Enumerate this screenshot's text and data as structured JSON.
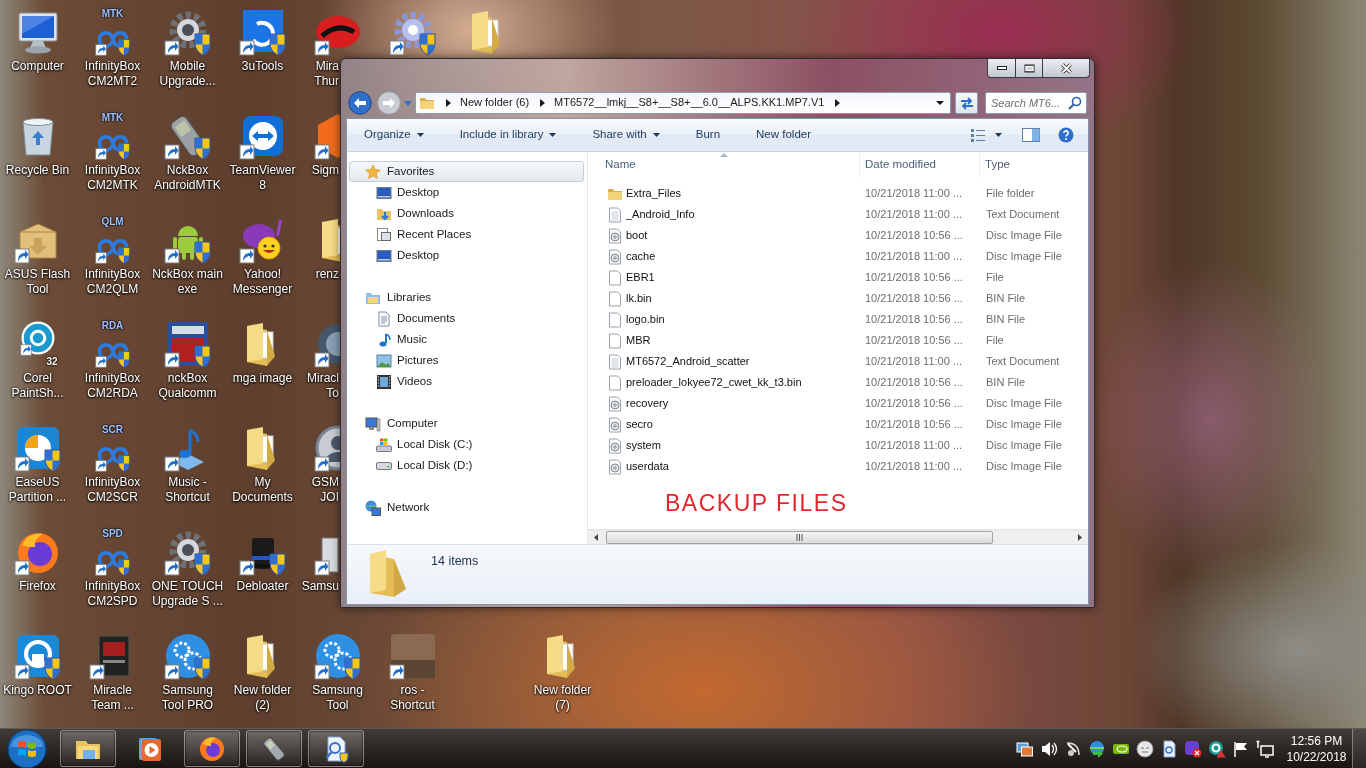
{
  "desktop": {
    "columns": [
      [
        {
          "label": "Computer",
          "kind": "computer",
          "shortcut": false,
          "shield": false
        },
        {
          "label": "Recycle Bin",
          "kind": "recycle",
          "shortcut": false,
          "shield": false
        },
        {
          "label": "ASUS Flash\nTool",
          "kind": "box",
          "shortcut": true,
          "shield": false
        },
        {
          "label": "Corel\nPaintSh...",
          "kind": "camera",
          "icon_text": "32",
          "shortcut": true,
          "shield": false
        },
        {
          "label": "EaseUS\nPartition ...",
          "kind": "easeus",
          "shortcut": true,
          "shield": true
        },
        {
          "label": "Firefox",
          "kind": "firefox",
          "shortcut": true,
          "shield": false
        },
        {
          "label": "Kingo ROOT",
          "kind": "kingo",
          "shortcut": true,
          "shield": true
        }
      ],
      [
        {
          "label": "InfinityBox\nCM2MT2",
          "kind": "infinity",
          "icon_text": "MTK",
          "shortcut": true,
          "shield": true
        },
        {
          "label": "InfinityBox\nCM2MTK",
          "kind": "infinity",
          "icon_text": "MTK",
          "shortcut": true,
          "shield": true
        },
        {
          "label": "InfinityBox\nCM2QLM",
          "kind": "infinity",
          "icon_text": "QLM",
          "shortcut": true,
          "shield": true
        },
        {
          "label": "InfinityBox\nCM2RDA",
          "kind": "infinity",
          "icon_text": "RDA",
          "shortcut": true,
          "shield": true
        },
        {
          "label": "InfinityBox\nCM2SCR",
          "kind": "infinity",
          "icon_text": "SCR",
          "shortcut": true,
          "shield": true
        },
        {
          "label": "InfinityBox\nCM2SPD",
          "kind": "infinity",
          "icon_text": "SPD",
          "shortcut": true,
          "shield": true
        },
        {
          "label": "Miracle\nTeam ...",
          "kind": "book",
          "shortcut": true,
          "shield": false
        }
      ],
      [
        {
          "label": "Mobile\nUpgrade...",
          "kind": "gear",
          "shortcut": true,
          "shield": true
        },
        {
          "label": "NckBox\nAndroidMTK",
          "kind": "phone",
          "shortcut": true,
          "shield": true
        },
        {
          "label": "NckBox main\nexe",
          "kind": "android",
          "shortcut": true,
          "shield": true
        },
        {
          "label": "nckBox\nQualcomm",
          "kind": "boxart",
          "shortcut": true,
          "shield": true
        },
        {
          "label": "Music -\nShortcut",
          "kind": "music",
          "shortcut": true,
          "shield": false
        },
        {
          "label": "ONE TOUCH\nUpgrade S ...",
          "kind": "gear",
          "shortcut": true,
          "shield": true
        },
        {
          "label": "Samsung\nTool PRO",
          "kind": "gears",
          "shortcut": true,
          "shield": true
        }
      ],
      [
        {
          "label": "3uTools",
          "kind": "tile3",
          "shortcut": true,
          "shield": true
        },
        {
          "label": "TeamViewer\n8",
          "kind": "teamviewer",
          "shortcut": true,
          "shield": false
        },
        {
          "label": "Yahoo!\nMessenger",
          "kind": "yahoo",
          "shortcut": true,
          "shield": false
        },
        {
          "label": "mga image",
          "kind": "folder",
          "shortcut": false,
          "shield": false
        },
        {
          "label": "My\nDocuments",
          "kind": "folder",
          "shortcut": false,
          "shield": false
        },
        {
          "label": "Debloater",
          "kind": "tophat",
          "shortcut": true,
          "shield": true
        },
        {
          "label": "New folder\n(2)",
          "kind": "folder",
          "shortcut": false,
          "shield": false
        }
      ],
      [
        {
          "label": "Mira\nThur",
          "kind": "miraclebox",
          "shortcut": true,
          "shield": false
        },
        {
          "label": "Sigm",
          "kind": "sigma",
          "shortcut": true
        },
        {
          "label": "renz",
          "kind": "folder",
          "shortcut": false
        },
        {
          "label": "Miracl\nTo",
          "kind": "darkgear",
          "shortcut": true
        },
        {
          "label": "GSM\nJOI",
          "kind": "avatar",
          "shortcut": true
        },
        {
          "label": "Samsu",
          "kind": "tower",
          "shortcut": true
        },
        {
          "label": "Samsung\nTool",
          "kind": "gears",
          "shortcut": true,
          "shield": true
        }
      ],
      [
        {
          "kind": "bluegear",
          "shortcut": true,
          "shield": true
        },
        {
          "label": "ros -\nShortcut",
          "kind": "photo",
          "shortcut": true,
          "shield": false
        }
      ],
      [
        {
          "kind": "folder",
          "shortcut": false,
          "shield": false
        }
      ],
      [
        {
          "label": "New folder\n(7)",
          "kind": "folder",
          "shortcut": false,
          "shield": false
        }
      ]
    ]
  },
  "explorer": {
    "back": {
      "disabled": false
    },
    "forward": {
      "disabled": true
    },
    "address": {
      "crumbs": [
        "New folder (6)",
        "MT6572__lmkj__S8+__S8+__6.0__ALPS.KK1.MP7.V1"
      ]
    },
    "search": {
      "placeholder": "Search MT6..."
    },
    "toolbar": [
      {
        "label": "Organize",
        "dropdown": true
      },
      {
        "label": "Include in library",
        "dropdown": true
      },
      {
        "label": "Share with",
        "dropdown": true
      },
      {
        "label": "Burn",
        "dropdown": false
      },
      {
        "label": "New folder",
        "dropdown": false
      }
    ],
    "nav": [
      {
        "label": "Favorites",
        "kind": "favorites",
        "selected": true,
        "children": [
          {
            "label": "Desktop",
            "kind": "desktop",
            "selected": false
          },
          {
            "label": "Downloads",
            "kind": "downloads",
            "selected": false
          },
          {
            "label": "Recent Places",
            "kind": "recent",
            "selected": false
          },
          {
            "label": "Desktop",
            "kind": "desktop",
            "selected": false
          }
        ]
      },
      {
        "label": "Libraries",
        "kind": "libraries",
        "selected": false,
        "children": [
          {
            "label": "Documents",
            "kind": "documents",
            "selected": false
          },
          {
            "label": "Music",
            "kind": "music",
            "selected": false
          },
          {
            "label": "Pictures",
            "kind": "pictures",
            "selected": false
          },
          {
            "label": "Videos",
            "kind": "videos",
            "selected": false
          }
        ]
      },
      {
        "label": "Computer",
        "kind": "computer",
        "selected": false,
        "children": [
          {
            "label": "Local Disk (C:)",
            "kind": "diskc",
            "selected": false
          },
          {
            "label": "Local Disk (D:)",
            "kind": "diskd",
            "selected": false
          }
        ]
      },
      {
        "label": "Network",
        "kind": "network",
        "selected": false
      }
    ],
    "columns": [
      {
        "label": "Name",
        "sorted": true
      },
      {
        "label": "Date modified",
        "sorted": false
      },
      {
        "label": "Type",
        "sorted": false
      }
    ],
    "files": [
      {
        "name": "Extra_Files",
        "date": "10/21/2018 11:00 ...",
        "type": "File folder",
        "kind": "folder"
      },
      {
        "name": "_Android_Info",
        "date": "10/21/2018 11:00 ...",
        "type": "Text Document",
        "kind": "text"
      },
      {
        "name": "boot",
        "date": "10/21/2018 10:56 ...",
        "type": "Disc Image File",
        "kind": "disc"
      },
      {
        "name": "cache",
        "date": "10/21/2018 11:00 ...",
        "type": "Disc Image File",
        "kind": "disc"
      },
      {
        "name": "EBR1",
        "date": "10/21/2018 10:56 ...",
        "type": "File",
        "kind": "file"
      },
      {
        "name": "lk.bin",
        "date": "10/21/2018 10:56 ...",
        "type": "BIN File",
        "kind": "file"
      },
      {
        "name": "logo.bin",
        "date": "10/21/2018 10:56 ...",
        "type": "BIN File",
        "kind": "file"
      },
      {
        "name": "MBR",
        "date": "10/21/2018 10:56 ...",
        "type": "File",
        "kind": "file"
      },
      {
        "name": "MT6572_Android_scatter",
        "date": "10/21/2018 11:00 ...",
        "type": "Text Document",
        "kind": "text"
      },
      {
        "name": "preloader_lokyee72_cwet_kk_t3.bin",
        "date": "10/21/2018 10:56 ...",
        "type": "BIN File",
        "kind": "file"
      },
      {
        "name": "recovery",
        "date": "10/21/2018 10:56 ...",
        "type": "Disc Image File",
        "kind": "disc"
      },
      {
        "name": "secro",
        "date": "10/21/2018 10:56 ...",
        "type": "Disc Image File",
        "kind": "disc"
      },
      {
        "name": "system",
        "date": "10/21/2018 11:00 ...",
        "type": "Disc Image File",
        "kind": "disc"
      },
      {
        "name": "userdata",
        "date": "10/21/2018 11:00 ...",
        "type": "Disc Image File",
        "kind": "disc"
      }
    ],
    "annotation": "BACKUP FILES",
    "status": "14 items"
  },
  "taskbar": {
    "buttons": [
      {
        "kind": "explorer",
        "running": true
      },
      {
        "kind": "player",
        "running": false
      },
      {
        "kind": "browser",
        "running": true
      },
      {
        "kind": "phone",
        "running": true
      },
      {
        "kind": "search",
        "running": true
      }
    ],
    "clock": {
      "time": "12:56 PM",
      "date": "10/22/2018"
    }
  }
}
